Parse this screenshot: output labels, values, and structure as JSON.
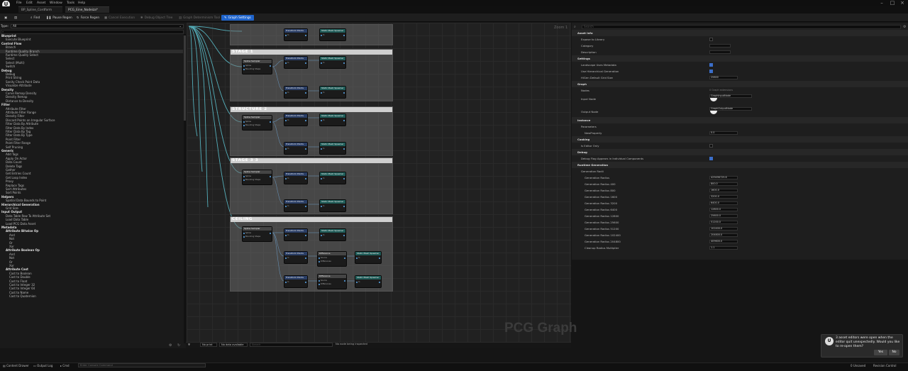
{
  "menu": [
    "File",
    "Edit",
    "Asset",
    "Window",
    "Tools",
    "Help"
  ],
  "tabs": [
    {
      "label": "BP_Spline_Cordform"
    },
    {
      "label": "PCG_Eine_Nodeiza*"
    }
  ],
  "toolbar": {
    "find": "Find",
    "pause_regen": "Pause Regen",
    "force_regen": "Force Regen",
    "cancel_execution": "Cancel Execution",
    "debug_object_tree": "Debug Object Tree",
    "graph_settings": "Graph Settings",
    "inspector": "Graph Determinism Tool"
  },
  "palette": {
    "type_label": "Type:",
    "type_value": "All",
    "items": [
      {
        "t": "Blueprint",
        "c": 1
      },
      {
        "t": "Execute Blueprint"
      },
      {
        "t": "Control Flow",
        "c": 1
      },
      {
        "t": "Branch"
      },
      {
        "t": "Runtime Quality Branch",
        "s": 1
      },
      {
        "t": "Runtime Quality Select"
      },
      {
        "t": "Select"
      },
      {
        "t": "Select (Multi)"
      },
      {
        "t": "Switch"
      },
      {
        "t": "Debug",
        "c": 1
      },
      {
        "t": "Debug"
      },
      {
        "t": "Print String"
      },
      {
        "t": "Sanity Check Point Data"
      },
      {
        "t": "Visualize Attribute"
      },
      {
        "t": "Density",
        "c": 1
      },
      {
        "t": "Curve Remap Density"
      },
      {
        "t": "Density Remap"
      },
      {
        "t": "Distance to Density"
      },
      {
        "t": "Filter",
        "c": 1
      },
      {
        "t": "Attribute Filter"
      },
      {
        "t": "Attribute Filter Range"
      },
      {
        "t": "Density Filter"
      },
      {
        "t": "Discard Points on Irregular Surface"
      },
      {
        "t": "Filter Data By Attribute"
      },
      {
        "t": "Filter Data By Index"
      },
      {
        "t": "Filter Data By Tag"
      },
      {
        "t": "Filter Data By Type"
      },
      {
        "t": "Point Filter"
      },
      {
        "t": "Point Filter Range"
      },
      {
        "t": "Self Pruning"
      },
      {
        "t": "Generic",
        "c": 1
      },
      {
        "t": "Add Tags"
      },
      {
        "t": "Apply On Actor"
      },
      {
        "t": "Data Count"
      },
      {
        "t": "Delete Tags"
      },
      {
        "t": "Gather"
      },
      {
        "t": "Get Entries Count"
      },
      {
        "t": "Get Loop Index"
      },
      {
        "t": "Proxy"
      },
      {
        "t": "Replace Tags"
      },
      {
        "t": "Sort Attributes"
      },
      {
        "t": "Sort Points"
      },
      {
        "t": "Helpers",
        "c": 1
      },
      {
        "t": "Spatial Data Bounds to Point"
      },
      {
        "t": "Hierarchical Generation",
        "c": 1
      },
      {
        "t": "Grid Size"
      },
      {
        "t": "Input Output",
        "c": 1
      },
      {
        "t": "Data Table Row To Attribute Set"
      },
      {
        "t": "Load Data Table"
      },
      {
        "t": "Load PCG Data Asset"
      },
      {
        "t": "Metadata",
        "c": 1
      },
      {
        "t": "Attribute Bitwise Op",
        "c": 1,
        "i": 1
      },
      {
        "t": "And",
        "i": 2
      },
      {
        "t": "Not",
        "i": 2
      },
      {
        "t": "Or",
        "i": 2
      },
      {
        "t": "Xor",
        "i": 2
      },
      {
        "t": "Attribute Boolean Op",
        "c": 1,
        "i": 1
      },
      {
        "t": "And",
        "i": 2
      },
      {
        "t": "Not",
        "i": 2
      },
      {
        "t": "Or",
        "i": 2
      },
      {
        "t": "Xor",
        "i": 2
      },
      {
        "t": "Attribute Cast",
        "c": 1,
        "i": 1
      },
      {
        "t": "Cast to Boolean",
        "i": 2
      },
      {
        "t": "Cast to Double",
        "i": 2
      },
      {
        "t": "Cast to Float",
        "i": 2
      },
      {
        "t": "Cast to Integer 32",
        "i": 2
      },
      {
        "t": "Cast to Integer 64",
        "i": 2
      },
      {
        "t": "Cast to Name",
        "i": 2
      },
      {
        "t": "Cast to Quaternion",
        "i": 2
      }
    ]
  },
  "graph": {
    "watermark": "PCG Graph",
    "zoom": "Zoom 1",
    "comments": [
      {
        "label": "STAGE 1"
      },
      {
        "label": "STRUCTURE 2"
      },
      {
        "label": "STAGE 3 3"
      },
      {
        "label": "CEILING"
      }
    ],
    "node_titles": {
      "spline": "Spline Sampler",
      "transform": "Transform Points",
      "static": "Static Mesh Spawner",
      "diff": "Difference"
    },
    "pins": {
      "spline": "Spline",
      "bounding": "Bounding Shape",
      "in": "In",
      "out": "Out",
      "source": "Source",
      "diff": "Differences"
    }
  },
  "messages": {
    "filter": "No print",
    "data": "No data available",
    "search": "Search",
    "status": "No node being inspected"
  },
  "details": {
    "search": "Search",
    "asset_info": "Asset Info",
    "expose": "Expose to Library",
    "category": "Category",
    "description": "Description",
    "settings": "Settings",
    "landscape": "Landscape Uses Metadata",
    "hierarchical": "Use Hierarchical Generation",
    "hgs": "HiGen Default Grid Size",
    "hgs_val": "25600",
    "graph": "Graph",
    "nodes": "Nodes",
    "nodes_val": "0 Graph extensions",
    "input_node": "Input Node",
    "output_node": "Output Node",
    "input_val": "GraphInputNode",
    "output_val": "GraphOutputNode",
    "instance": "Instance",
    "parameters": "Parameters",
    "param_item": "NewProperty",
    "param_val": "0.0",
    "cooking": "Cooking",
    "editor_only": "Is Editor Only",
    "debug": "Debug",
    "debug_flag": "Debug Flag Appears in Individual Components",
    "runtime": "Runtime Generation",
    "gen_radii": "Generation Radii",
    "radii": [
      {
        "k": "Generation Radius",
        "v": "429496729.6"
      },
      {
        "k": "Generation Radius 400",
        "v": "800.0"
      },
      {
        "k": "Generation Radius 800",
        "v": "1600.0"
      },
      {
        "k": "Generation Radius 1600",
        "v": "3200.0"
      },
      {
        "k": "Generation Radius 3200",
        "v": "6400.0"
      },
      {
        "k": "Generation Radius 6400",
        "v": "12800.0"
      },
      {
        "k": "Generation Radius 12800",
        "v": "25600.0"
      },
      {
        "k": "Generation Radius 25600",
        "v": "51200.0"
      },
      {
        "k": "Generation Radius 51200",
        "v": "102400.0"
      },
      {
        "k": "Generation Radius 102400",
        "v": "204800.0"
      },
      {
        "k": "Generation Radius 204800",
        "v": "409600.0"
      },
      {
        "k": "Cleanup Radius Multiplier",
        "v": "1.1"
      }
    ]
  },
  "statusbar": {
    "content_drawer": "Content Drawer",
    "output_log": "Output Log",
    "cmd": "Cmd",
    "cmd_placeholder": "Enter Console Command",
    "unsaved": "0 Unsaved",
    "revision": "Revision Control"
  },
  "toast": {
    "message": "3 asset editors were open when the editor quit unexpectedly. Would you like to re-open them?",
    "yes": "Yes",
    "no": "No"
  }
}
